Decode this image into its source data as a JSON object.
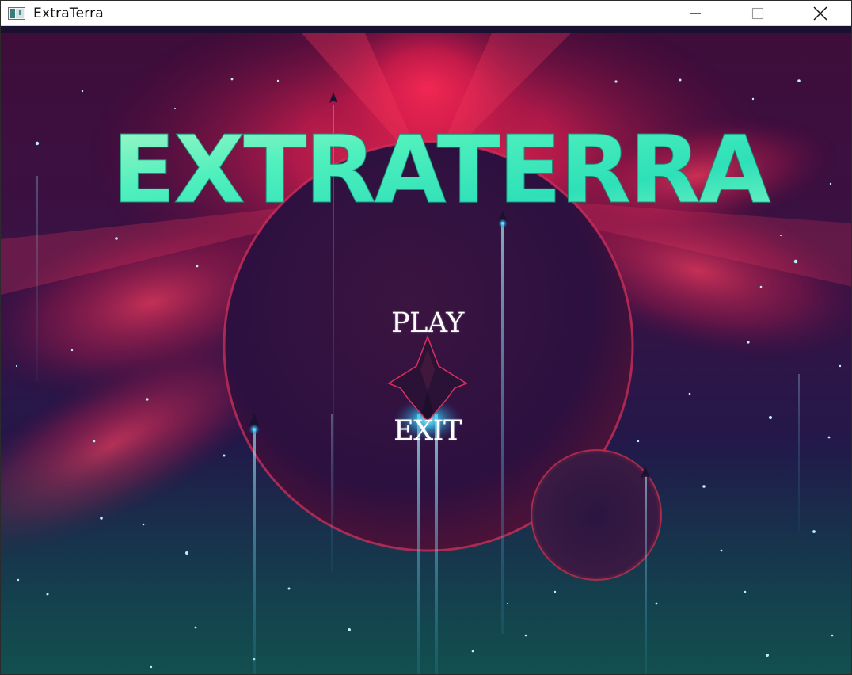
{
  "window": {
    "title": "ExtraTerra"
  },
  "game": {
    "title": "EXTRATERRA",
    "menu": {
      "play_label": "PLAY",
      "exit_label": "EXIT"
    }
  },
  "colors": {
    "title_fill": "#4ff0bd",
    "title_fill_light": "#a8f7c7",
    "space_dark": "#1d1240",
    "nebula_red": "#ff2a55",
    "planet": "#3b1440",
    "engine_glow": "#39d3ff",
    "menu_text": "#ffffff"
  }
}
